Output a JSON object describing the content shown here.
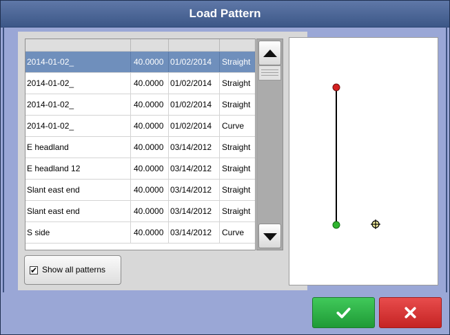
{
  "dialog": {
    "title": "Load Pattern"
  },
  "table": {
    "rows": [
      {
        "name": "2014-01-02_",
        "width": "40.0000",
        "date": "01/02/2014",
        "type": "Straight",
        "selected": true
      },
      {
        "name": "2014-01-02_",
        "width": "40.0000",
        "date": "01/02/2014",
        "type": "Straight"
      },
      {
        "name": "2014-01-02_",
        "width": "40.0000",
        "date": "01/02/2014",
        "type": "Straight"
      },
      {
        "name": "2014-01-02_",
        "width": "40.0000",
        "date": "01/02/2014",
        "type": "Curve"
      },
      {
        "name": "E headland",
        "width": "40.0000",
        "date": "03/14/2012",
        "type": "Straight"
      },
      {
        "name": "E headland 12",
        "width": "40.0000",
        "date": "03/14/2012",
        "type": "Straight"
      },
      {
        "name": "Slant east end",
        "width": "40.0000",
        "date": "03/14/2012",
        "type": "Straight"
      },
      {
        "name": "Slant east end",
        "width": "40.0000",
        "date": "03/14/2012",
        "type": "Straight"
      },
      {
        "name": "S side",
        "width": "40.0000",
        "date": "03/14/2012",
        "type": "Curve"
      }
    ]
  },
  "scrollbar": {
    "up_icon": "triangle-up-icon",
    "down_icon": "triangle-down-icon"
  },
  "show_all": {
    "label": "Show all patterns",
    "checked": true
  },
  "preview": {
    "start_marker_color": "#d42020",
    "end_marker_color": "#2fb52f",
    "vehicle_icon": "crosshair-icon"
  },
  "actions": {
    "ok_icon": "checkmark-icon",
    "cancel_icon": "x-icon",
    "ok_color": "#2db44a",
    "cancel_color": "#d93636"
  }
}
